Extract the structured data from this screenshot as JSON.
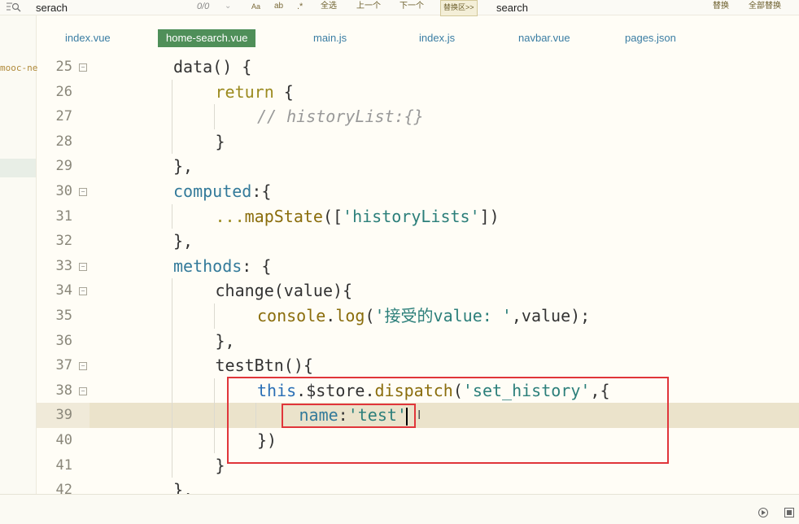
{
  "findbar": {
    "find_value": "serach",
    "match_count": "0/0",
    "prev_arrow": "⌄",
    "opt_case": "Aa",
    "opt_word": "ab",
    "opt_regex": ".*",
    "select_all": "全选",
    "prev": "上一个",
    "next": "下一个",
    "replace_toggle": "替换区>>",
    "replace_value": "search",
    "replace": "替换",
    "replace_all": "全部替换"
  },
  "sidebar": {
    "project_label": "mooc-ne"
  },
  "tabs": [
    {
      "label": "index.vue",
      "active": false
    },
    {
      "label": "home-search.vue",
      "active": true
    },
    {
      "label": "main.js",
      "active": false
    },
    {
      "label": "index.js",
      "active": false
    },
    {
      "label": "navbar.vue",
      "active": false
    },
    {
      "label": "pages.json",
      "active": false
    }
  ],
  "editor": {
    "current_line": 39,
    "lines": [
      {
        "n": "25",
        "fold": true,
        "indent": 0,
        "code": "data() {"
      },
      {
        "n": "26",
        "fold": false,
        "indent": 1,
        "code": "return {"
      },
      {
        "n": "27",
        "fold": false,
        "indent": 2,
        "code": "// historyList:{}"
      },
      {
        "n": "28",
        "fold": false,
        "indent": 1,
        "code": "}"
      },
      {
        "n": "29",
        "fold": false,
        "indent": 0,
        "code": "},"
      },
      {
        "n": "30",
        "fold": true,
        "indent": 0,
        "code": "computed:{"
      },
      {
        "n": "31",
        "fold": false,
        "indent": 1,
        "code": "...mapState(['historyLists'])"
      },
      {
        "n": "32",
        "fold": false,
        "indent": 0,
        "code": "},"
      },
      {
        "n": "33",
        "fold": true,
        "indent": 0,
        "code": "methods: {"
      },
      {
        "n": "34",
        "fold": true,
        "indent": 1,
        "code": "change(value){"
      },
      {
        "n": "35",
        "fold": false,
        "indent": 2,
        "code": "console.log('接受的value: ',value);"
      },
      {
        "n": "36",
        "fold": false,
        "indent": 1,
        "code": "},"
      },
      {
        "n": "37",
        "fold": true,
        "indent": 1,
        "code": "testBtn(){"
      },
      {
        "n": "38",
        "fold": true,
        "indent": 2,
        "code": "this.$store.dispatch('set_history',{"
      },
      {
        "n": "39",
        "fold": false,
        "indent": 3,
        "code": "name:'test'"
      },
      {
        "n": "40",
        "fold": false,
        "indent": 2,
        "code": "})"
      },
      {
        "n": "41",
        "fold": false,
        "indent": 1,
        "code": "}"
      },
      {
        "n": "42",
        "fold": false,
        "indent": 0,
        "code": "},"
      }
    ]
  },
  "colors": {
    "active_tab": "#4f8f59",
    "annotation": "#e0353a",
    "keyword": "#9b8a1f",
    "string": "#2c7f7a"
  }
}
